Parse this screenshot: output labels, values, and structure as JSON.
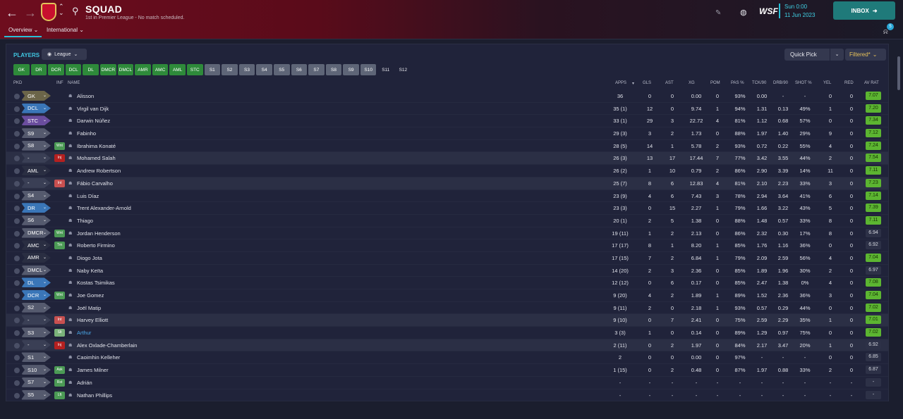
{
  "header": {
    "title": "SQUAD",
    "subtitle": "1st in Premier League - No match scheduled.",
    "subnav": {
      "overview": "Overview",
      "international": "International"
    },
    "date_time": "Sun 0:00",
    "date_day": "11 Jun 2023",
    "inbox_label": "INBOX",
    "logo_text": "WSF",
    "notif_count": "5"
  },
  "toolbar": {
    "players_label": "PLAYERS",
    "league_label": "League",
    "quick_pick_label": "Quick Pick",
    "filtered_label": "Filtered*"
  },
  "position_filters": [
    {
      "label": "GK",
      "style": "green"
    },
    {
      "label": "DR",
      "style": "green"
    },
    {
      "label": "DCR",
      "style": "green"
    },
    {
      "label": "DCL",
      "style": "green"
    },
    {
      "label": "DL",
      "style": "green"
    },
    {
      "label": "DMCR",
      "style": "green"
    },
    {
      "label": "DMCL",
      "style": "green"
    },
    {
      "label": "AMR",
      "style": "green"
    },
    {
      "label": "AMC",
      "style": "green"
    },
    {
      "label": "AML",
      "style": "green"
    },
    {
      "label": "STC",
      "style": "green"
    },
    {
      "label": "S1",
      "style": "grey"
    },
    {
      "label": "S2",
      "style": "grey"
    },
    {
      "label": "S3",
      "style": "grey"
    },
    {
      "label": "S4",
      "style": "grey"
    },
    {
      "label": "S5",
      "style": "grey"
    },
    {
      "label": "S6",
      "style": "grey"
    },
    {
      "label": "S7",
      "style": "grey"
    },
    {
      "label": "S8",
      "style": "grey"
    },
    {
      "label": "S9",
      "style": "grey"
    },
    {
      "label": "S10",
      "style": "grey"
    },
    {
      "label": "S11",
      "style": "dark"
    },
    {
      "label": "S12",
      "style": "dark"
    }
  ],
  "columns": {
    "pkd": "PKD",
    "inf": "INF",
    "name": "NAME",
    "apps": "APPS",
    "gls": "GLS",
    "ast": "AST",
    "xg": "XG",
    "pom": "POM",
    "pas": "PAS %",
    "tck": "TCK/90",
    "drb": "DRB/90",
    "shot": "SHOT %",
    "yel": "YEL",
    "red": "RED",
    "avrat": "AV RAT"
  },
  "players": [
    {
      "pos": "GK",
      "pos_color": "#6b6549",
      "inf": "",
      "inf_color": "",
      "name": "Alisson",
      "apps": "36",
      "gls": "0",
      "ast": "0",
      "xg": "0.00",
      "pom": "0",
      "pas": "93%",
      "tck": "0.00",
      "drb": "-",
      "shot": "-",
      "yel": "0",
      "red": "0",
      "avrat": "7.07",
      "rat_style": "green"
    },
    {
      "pos": "DCL",
      "pos_color": "#3a76b8",
      "inf": "",
      "inf_color": "",
      "name": "Virgil van Dijk",
      "apps": "35 (1)",
      "gls": "12",
      "ast": "0",
      "xg": "9.74",
      "pom": "1",
      "pas": "94%",
      "tck": "1.31",
      "drb": "0.13",
      "shot": "49%",
      "yel": "1",
      "red": "0",
      "avrat": "7.20",
      "rat_style": "green"
    },
    {
      "pos": "STC",
      "pos_color": "#6a4d9e",
      "inf": "",
      "inf_color": "",
      "name": "Darwin Núñez",
      "apps": "33 (1)",
      "gls": "29",
      "ast": "3",
      "xg": "22.72",
      "pom": "4",
      "pas": "81%",
      "tck": "1.12",
      "drb": "0.68",
      "shot": "57%",
      "yel": "0",
      "red": "0",
      "avrat": "7.34",
      "rat_style": "green"
    },
    {
      "pos": "S9",
      "pos_color": "#555a6e",
      "inf": "",
      "inf_color": "",
      "name": "Fabinho",
      "apps": "29 (3)",
      "gls": "3",
      "ast": "2",
      "xg": "1.73",
      "pom": "0",
      "pas": "88%",
      "tck": "1.97",
      "drb": "1.40",
      "shot": "29%",
      "yel": "9",
      "red": "0",
      "avrat": "7.12",
      "rat_style": "green"
    },
    {
      "pos": "S8",
      "pos_color": "#555a6e",
      "inf": "Wnt",
      "inf_color": "#4b9a55",
      "name": "Ibrahima Konaté",
      "apps": "28 (5)",
      "gls": "14",
      "ast": "1",
      "xg": "5.78",
      "pom": "2",
      "pas": "93%",
      "tck": "0.72",
      "drb": "0.22",
      "shot": "55%",
      "yel": "4",
      "red": "0",
      "avrat": "7.24",
      "rat_style": "green"
    },
    {
      "pos": "-",
      "pos_color": "#3a3f55",
      "inf": "Inj",
      "inf_color": "#b42020",
      "name": "Mohamed Salah",
      "apps": "26 (3)",
      "gls": "13",
      "ast": "17",
      "xg": "17.44",
      "pom": "7",
      "pas": "77%",
      "tck": "3.42",
      "drb": "3.55",
      "shot": "44%",
      "yel": "2",
      "red": "0",
      "avrat": "7.54",
      "rat_style": "green"
    },
    {
      "pos": "AML",
      "pos_color": "#2a2e42",
      "inf": "",
      "inf_color": "",
      "name": "Andrew Robertson",
      "apps": "26 (2)",
      "gls": "1",
      "ast": "10",
      "xg": "0.79",
      "pom": "2",
      "pas": "86%",
      "tck": "2.90",
      "drb": "3.39",
      "shot": "14%",
      "yel": "11",
      "red": "0",
      "avrat": "7.11",
      "rat_style": "green"
    },
    {
      "pos": "-",
      "pos_color": "#3a3f55",
      "inf": "Int",
      "inf_color": "#c85050",
      "name": "Fábio Carvalho",
      "apps": "25 (7)",
      "gls": "8",
      "ast": "6",
      "xg": "12.83",
      "pom": "4",
      "pas": "81%",
      "tck": "2.10",
      "drb": "2.23",
      "shot": "33%",
      "yel": "3",
      "red": "0",
      "avrat": "7.23",
      "rat_style": "green"
    },
    {
      "pos": "S4",
      "pos_color": "#555a6e",
      "inf": "",
      "inf_color": "",
      "name": "Luis Díaz",
      "apps": "23 (9)",
      "gls": "4",
      "ast": "6",
      "xg": "7.43",
      "pom": "3",
      "pas": "78%",
      "tck": "2.94",
      "drb": "3.64",
      "shot": "41%",
      "yel": "6",
      "red": "0",
      "avrat": "7.14",
      "rat_style": "green"
    },
    {
      "pos": "DR",
      "pos_color": "#3a76b8",
      "inf": "",
      "inf_color": "",
      "name": "Trent Alexander-Arnold",
      "apps": "23 (3)",
      "gls": "0",
      "ast": "15",
      "xg": "2.27",
      "pom": "1",
      "pas": "79%",
      "tck": "1.66",
      "drb": "3.22",
      "shot": "43%",
      "yel": "5",
      "red": "0",
      "avrat": "7.39",
      "rat_style": "green"
    },
    {
      "pos": "S6",
      "pos_color": "#555a6e",
      "inf": "",
      "inf_color": "",
      "name": "Thiago",
      "apps": "20 (1)",
      "gls": "2",
      "ast": "5",
      "xg": "1.38",
      "pom": "0",
      "pas": "88%",
      "tck": "1.48",
      "drb": "0.57",
      "shot": "33%",
      "yel": "8",
      "red": "0",
      "avrat": "7.11",
      "rat_style": "green"
    },
    {
      "pos": "DMCR",
      "pos_color": "#555a6e",
      "inf": "Wnt",
      "inf_color": "#4b9a55",
      "name": "Jordan Henderson",
      "apps": "19 (11)",
      "gls": "1",
      "ast": "2",
      "xg": "2.13",
      "pom": "0",
      "pas": "86%",
      "tck": "2.32",
      "drb": "0.30",
      "shot": "17%",
      "yel": "8",
      "red": "0",
      "avrat": "6.94",
      "rat_style": "dark"
    },
    {
      "pos": "AMC",
      "pos_color": "#2a2e42",
      "inf": "Trn",
      "inf_color": "#4b9a55",
      "name": "Roberto Firmino",
      "apps": "17 (17)",
      "gls": "8",
      "ast": "1",
      "xg": "8.20",
      "pom": "1",
      "pas": "85%",
      "tck": "1.76",
      "drb": "1.16",
      "shot": "36%",
      "yel": "0",
      "red": "0",
      "avrat": "6.92",
      "rat_style": "dark"
    },
    {
      "pos": "AMR",
      "pos_color": "#2a2e42",
      "inf": "",
      "inf_color": "",
      "name": "Diogo Jota",
      "apps": "17 (15)",
      "gls": "7",
      "ast": "2",
      "xg": "6.84",
      "pom": "1",
      "pas": "79%",
      "tck": "2.09",
      "drb": "2.59",
      "shot": "56%",
      "yel": "4",
      "red": "0",
      "avrat": "7.04",
      "rat_style": "green"
    },
    {
      "pos": "DMCL",
      "pos_color": "#555a6e",
      "inf": "",
      "inf_color": "",
      "name": "Naby Keïta",
      "apps": "14 (20)",
      "gls": "2",
      "ast": "3",
      "xg": "2.36",
      "pom": "0",
      "pas": "85%",
      "tck": "1.89",
      "drb": "1.96",
      "shot": "30%",
      "yel": "2",
      "red": "0",
      "avrat": "6.97",
      "rat_style": "dark"
    },
    {
      "pos": "DL",
      "pos_color": "#3a76b8",
      "inf": "",
      "inf_color": "",
      "name": "Kostas Tsimikas",
      "apps": "12 (12)",
      "gls": "0",
      "ast": "6",
      "xg": "0.17",
      "pom": "0",
      "pas": "85%",
      "tck": "2.47",
      "drb": "1.38",
      "shot": "0%",
      "yel": "4",
      "red": "0",
      "avrat": "7.08",
      "rat_style": "green"
    },
    {
      "pos": "DCR",
      "pos_color": "#3a76b8",
      "inf": "Wnt",
      "inf_color": "#4b9a55",
      "name": "Joe Gomez",
      "apps": "9 (20)",
      "gls": "4",
      "ast": "2",
      "xg": "1.89",
      "pom": "1",
      "pas": "89%",
      "tck": "1.52",
      "drb": "2.36",
      "shot": "36%",
      "yel": "3",
      "red": "0",
      "avrat": "7.04",
      "rat_style": "green"
    },
    {
      "pos": "S2",
      "pos_color": "#555a6e",
      "inf": "",
      "inf_color": "",
      "name": "Joël Matip",
      "apps": "9 (11)",
      "gls": "2",
      "ast": "0",
      "xg": "2.18",
      "pom": "1",
      "pas": "93%",
      "tck": "0.57",
      "drb": "0.29",
      "shot": "44%",
      "yel": "0",
      "red": "0",
      "avrat": "7.02",
      "rat_style": "green"
    },
    {
      "pos": "-",
      "pos_color": "#3a3f55",
      "inf": "Int",
      "inf_color": "#c85050",
      "name": "Harvey Elliott",
      "apps": "9 (10)",
      "gls": "0",
      "ast": "7",
      "xg": "2.41",
      "pom": "0",
      "pas": "75%",
      "tck": "2.59",
      "drb": "2.29",
      "shot": "35%",
      "yel": "1",
      "red": "0",
      "avrat": "7.01",
      "rat_style": "green"
    },
    {
      "pos": "S3",
      "pos_color": "#555a6e",
      "inf": "Slt",
      "inf_color": "#7ab27a",
      "name": "Arthur",
      "apps": "3 (3)",
      "gls": "1",
      "ast": "0",
      "xg": "0.14",
      "pom": "0",
      "pas": "89%",
      "tck": "1.29",
      "drb": "0.97",
      "shot": "75%",
      "yel": "0",
      "red": "0",
      "avrat": "7.02",
      "rat_style": "green",
      "name_color": "#4aa8e8"
    },
    {
      "pos": "-",
      "pos_color": "#3a3f55",
      "inf": "Inj",
      "inf_color": "#b42020",
      "name": "Alex Oxlade-Chamberlain",
      "apps": "2 (11)",
      "gls": "0",
      "ast": "2",
      "xg": "1.97",
      "pom": "0",
      "pas": "84%",
      "tck": "2.17",
      "drb": "3.47",
      "shot": "20%",
      "yel": "1",
      "red": "0",
      "avrat": "6.92",
      "rat_style": "dark"
    },
    {
      "pos": "S1",
      "pos_color": "#555a6e",
      "inf": "",
      "inf_color": "",
      "name": "Caoimhin Kelleher",
      "apps": "2",
      "gls": "0",
      "ast": "0",
      "xg": "0.00",
      "pom": "0",
      "pas": "97%",
      "tck": "-",
      "drb": "-",
      "shot": "-",
      "yel": "0",
      "red": "0",
      "avrat": "6.85",
      "rat_style": "dark"
    },
    {
      "pos": "S10",
      "pos_color": "#555a6e",
      "inf": "Ask",
      "inf_color": "#4b9a55",
      "name": "James Milner",
      "apps": "1 (15)",
      "gls": "0",
      "ast": "2",
      "xg": "0.48",
      "pom": "0",
      "pas": "87%",
      "tck": "1.97",
      "drb": "0.88",
      "shot": "33%",
      "yel": "2",
      "red": "0",
      "avrat": "6.87",
      "rat_style": "dark"
    },
    {
      "pos": "S7",
      "pos_color": "#555a6e",
      "inf": "Rst",
      "inf_color": "#4b9a55",
      "name": "Adrián",
      "apps": "-",
      "gls": "-",
      "ast": "-",
      "xg": "-",
      "pom": "-",
      "pas": "-",
      "tck": "-",
      "drb": "-",
      "shot": "-",
      "yel": "-",
      "red": "-",
      "avrat": "-",
      "rat_style": "dark"
    },
    {
      "pos": "S5",
      "pos_color": "#555a6e",
      "inf": "Lft",
      "inf_color": "#4b9a55",
      "name": "Nathan Phillips",
      "apps": "-",
      "gls": "-",
      "ast": "-",
      "xg": "-",
      "pom": "-",
      "pas": "-",
      "tck": "-",
      "drb": "-",
      "shot": "-",
      "yel": "-",
      "red": "-",
      "avrat": "-",
      "rat_style": "dark"
    }
  ]
}
